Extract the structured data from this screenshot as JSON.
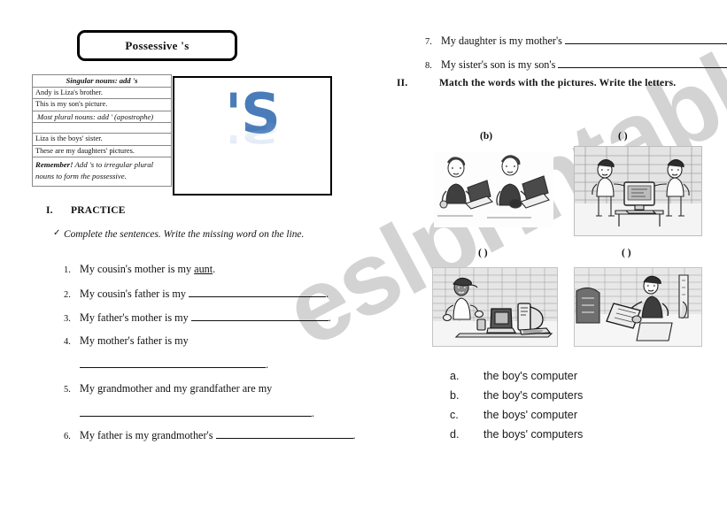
{
  "watermark": {
    "text": "eslprintables.com"
  },
  "title": {
    "text": "Possessive 's"
  },
  "rules_table": {
    "rows": [
      {
        "type": "header",
        "text": "Singular nouns: add 's"
      },
      {
        "type": "example",
        "text": "Andy is Liza's brother."
      },
      {
        "type": "example",
        "text": "This is my son's picture."
      },
      {
        "type": "subheader",
        "text": "Most plural nouns: add ' (apostrophe)"
      },
      {
        "type": "spacer",
        "text": ""
      },
      {
        "type": "example",
        "text": "Liza is the boys' sister."
      },
      {
        "type": "example",
        "text": "These are my daughters' pictures."
      },
      {
        "type": "remember",
        "bold": "Remember!",
        "text": " Add  's to irregular plural nouns to form the possessive."
      }
    ]
  },
  "illustration": {
    "glyph": "'S",
    "color": "#4a7cba",
    "reflection_color": "#9ebbdd"
  },
  "sections": {
    "practice": {
      "number": "I.",
      "label": "PRACTICE"
    },
    "match": {
      "number": "II.",
      "label": "Match the words with the pictures. Write the letters."
    }
  },
  "instruction": {
    "check": "✓",
    "text": "Complete the sentences. Write the missing word on the line."
  },
  "questions": [
    {
      "n": "1.",
      "pre": "My cousin's mother is my ",
      "answer": "aunt",
      "post": ".",
      "blank": "none"
    },
    {
      "n": "2.",
      "pre": "My cousin's father is my ",
      "answer": "",
      "post": ".",
      "blank": "long"
    },
    {
      "n": "3.",
      "pre": "My father's mother is my ",
      "answer": "",
      "post": ".",
      "blank": "long"
    },
    {
      "n": "4.",
      "pre": "My mother's father is my",
      "answer": "",
      "post": ".",
      "blank": "wrap-xlong"
    },
    {
      "n": "5.",
      "pre": "My grandmother and my grandfather are my",
      "answer": "",
      "post": ".",
      "blank": "wrap-xlong"
    },
    {
      "n": "6.",
      "pre": "My father is my grandmother's ",
      "answer": "",
      "post": ".",
      "blank": "long"
    },
    {
      "n": "7.",
      "pre": "My daughter is my mother's ",
      "answer": "",
      "post": ".",
      "blank": "xlong"
    },
    {
      "n": "8.",
      "pre": "My sister's son is my son's ",
      "answer": "",
      "post": ".",
      "blank": "xlong"
    }
  ],
  "pictures": [
    {
      "id": "pic-top-left",
      "label": "(b)",
      "alt": "two boys each with a laptop computer"
    },
    {
      "id": "pic-top-right",
      "label": "(  )",
      "alt": "two boys with one desktop computer"
    },
    {
      "id": "pic-bottom-left",
      "label": "(  )",
      "alt": "one boy with several computers"
    },
    {
      "id": "pic-bottom-right",
      "label": "(  )",
      "alt": "one boy with one computer"
    }
  ],
  "options": [
    {
      "letter": "a.",
      "text": "the boy's computer"
    },
    {
      "letter": "b.",
      "text": "the boy's computers"
    },
    {
      "letter": "c.",
      "text": "the boys' computer"
    },
    {
      "letter": "d.",
      "text": "the boys' computers"
    }
  ]
}
